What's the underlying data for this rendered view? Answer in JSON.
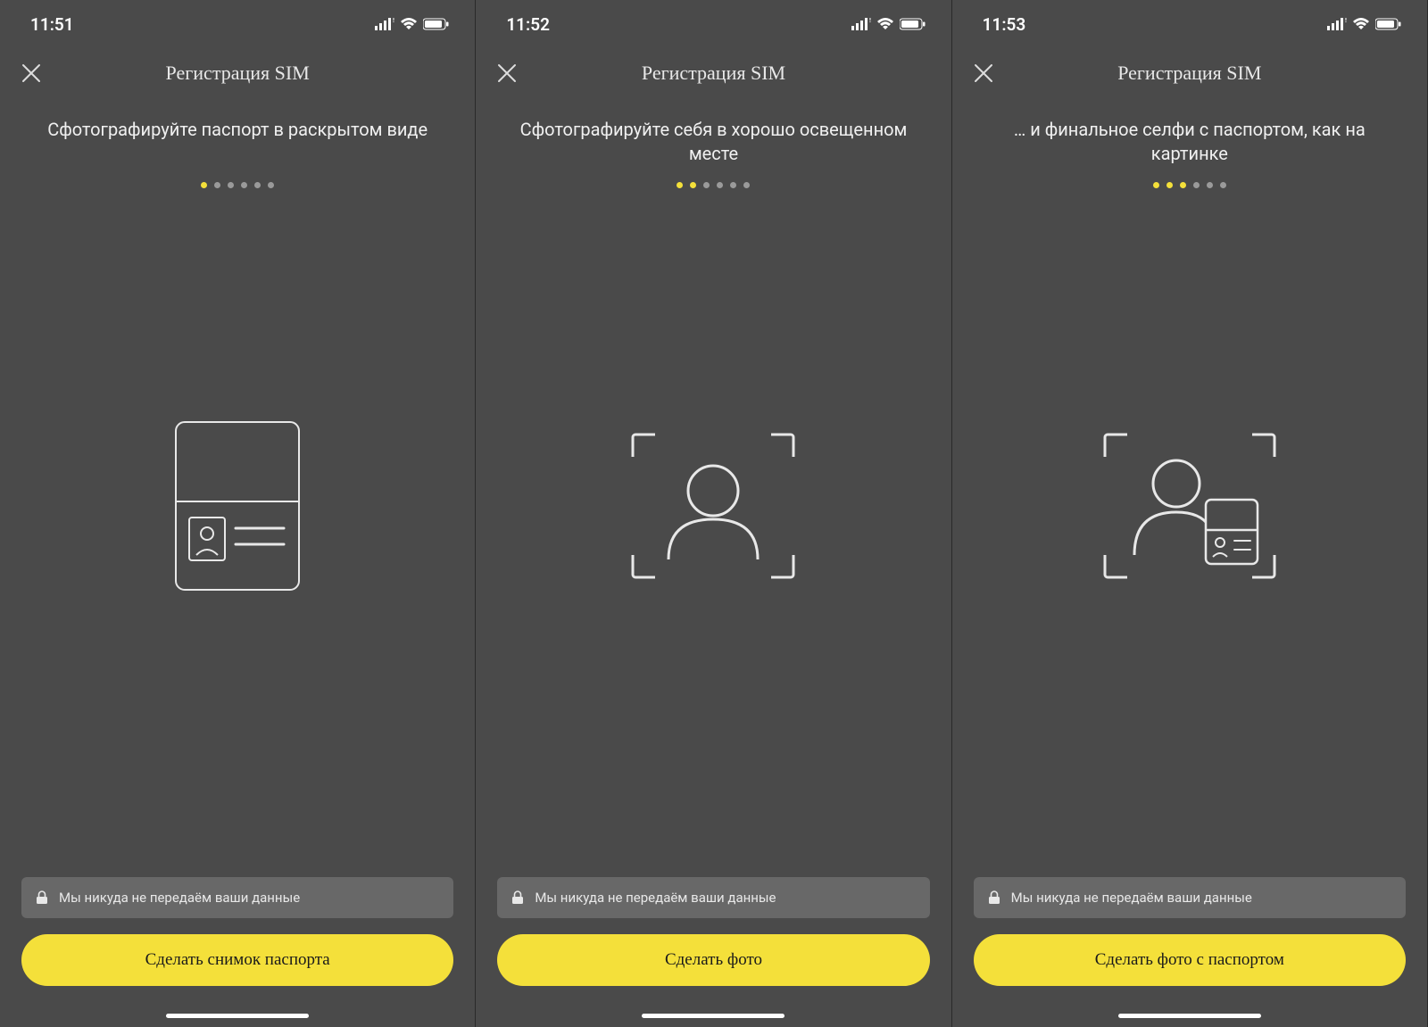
{
  "screens": [
    {
      "time": "11:51",
      "title": "Регистрация SIM",
      "instruction": "Сфотографируйте паспорт в раскрытом виде",
      "totalDots": 6,
      "activeDots": 1,
      "illustration": "passport",
      "privacy": "Мы никуда не передаём ваши данные",
      "cta": "Сделать снимок паспорта"
    },
    {
      "time": "11:52",
      "title": "Регистрация SIM",
      "instruction": "Сфотографируйте себя в хорошо освещенном месте",
      "totalDots": 6,
      "activeDots": 2,
      "illustration": "selfie",
      "privacy": "Мы никуда не передаём ваши данные",
      "cta": "Сделать фото"
    },
    {
      "time": "11:53",
      "title": "Регистрация SIM",
      "instruction": "… и финальное селфи с паспортом, как на картинке",
      "totalDots": 6,
      "activeDots": 3,
      "illustration": "selfie-passport",
      "privacy": "Мы никуда не передаём ваши данные",
      "cta": "Сделать фото с паспортом"
    }
  ],
  "colors": {
    "accent": "#f4e03a",
    "background": "#4a4a4a",
    "text": "#f0f0f0"
  }
}
